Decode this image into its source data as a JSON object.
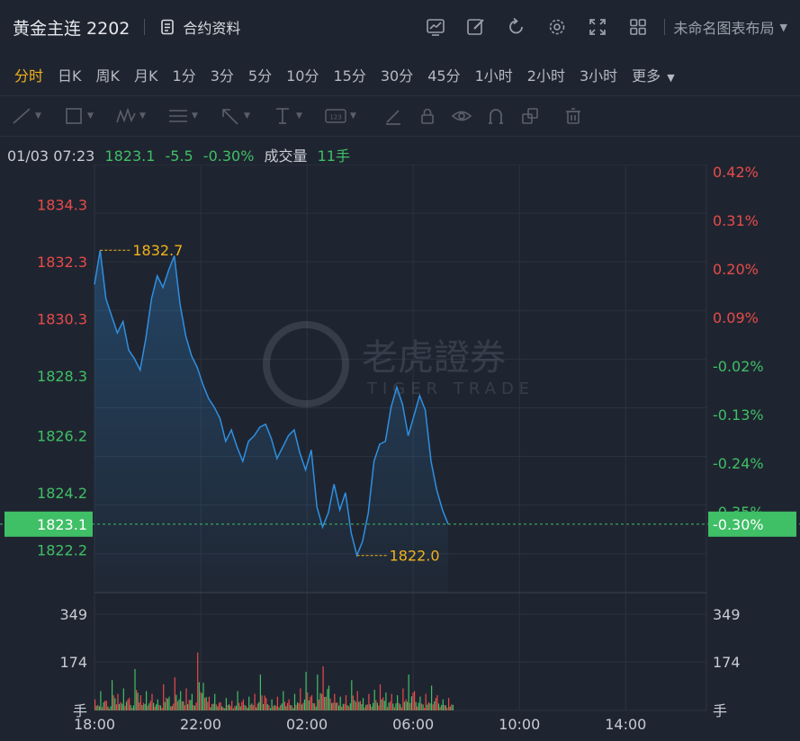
{
  "header": {
    "title": "黄金主连 2202",
    "contract_info_label": "合约资料",
    "layout_label": "未命名图表布局",
    "tool_icons": [
      "indicator-chart-icon",
      "draw-pen-icon",
      "refresh-icon",
      "settings-gear-icon",
      "fullscreen-icon",
      "grid-layout-icon"
    ]
  },
  "periods": {
    "items": [
      "分时",
      "日K",
      "周K",
      "月K",
      "1分",
      "3分",
      "5分",
      "10分",
      "15分",
      "30分",
      "45分",
      "1小时",
      "2小时",
      "3小时",
      "更多"
    ],
    "active": "分时"
  },
  "drawing_tools": [
    "line-tool-icon",
    "rectangle-tool-icon",
    "wave-pattern-icon",
    "fibonacci-icon",
    "arrow-tool-icon",
    "vertical-line-icon",
    "label-tool-icon",
    "pen-icon",
    "lock-icon",
    "eye-icon",
    "magnet-icon",
    "layers-icon",
    "trash-icon"
  ],
  "info": {
    "datetime": "01/03 07:23",
    "price": "1823.1",
    "change": "-5.5",
    "change_pct": "-0.30%",
    "volume_label": "成交量",
    "volume_value": "11手"
  },
  "watermark": {
    "cn": "老虎證券",
    "en": "TIGER TRADE"
  },
  "colors": {
    "up": "#e84a4a",
    "down": "#3fbf66",
    "line": "#2f8fe0",
    "accent": "#f2b21b",
    "grid": "#2b3340",
    "bg": "#1f2530"
  },
  "chart_data": {
    "type": "line",
    "price_ticks_left": [
      "1834.3",
      "1832.3",
      "1830.3",
      "1828.3",
      "1826.2",
      "1824.2",
      "1822.2"
    ],
    "price_ticks_left_values": [
      1834.3,
      1832.3,
      1830.3,
      1828.3,
      1826.2,
      1824.2,
      1822.2
    ],
    "pct_ticks_right": [
      "0.42%",
      "0.31%",
      "0.20%",
      "0.09%",
      "-0.02%",
      "-0.13%",
      "-0.24%",
      "-0.35%"
    ],
    "current_price": "1823.1",
    "current_pct": "-0.30%",
    "high_label": "1832.7",
    "low_label": "1822.0",
    "x_ticks": [
      "18:00",
      "22:00",
      "02:00",
      "06:00",
      "10:00",
      "14:00"
    ],
    "ylim": [
      1820.7,
      1835.7
    ],
    "series": [
      {
        "values": [
          1831.5,
          1832.7,
          1831.0,
          1830.4,
          1829.8,
          1830.2,
          1829.2,
          1828.9,
          1828.5,
          1829.6,
          1831.0,
          1831.8,
          1831.4,
          1832.0,
          1832.5,
          1830.8,
          1829.7,
          1829.0,
          1828.6,
          1828.0,
          1827.5,
          1827.2,
          1826.8,
          1826.0,
          1826.4,
          1825.8,
          1825.3,
          1826.0,
          1826.2,
          1826.5,
          1826.6,
          1826.1,
          1825.4,
          1825.8,
          1826.2,
          1826.4,
          1825.6,
          1825.0,
          1825.7,
          1823.7,
          1823.0,
          1823.5,
          1824.5,
          1823.6,
          1824.2,
          1822.8,
          1822.0,
          1822.5,
          1823.5,
          1825.3,
          1825.9,
          1826.0,
          1827.2,
          1827.9,
          1827.3,
          1826.2,
          1826.9,
          1827.6,
          1827.1,
          1825.3,
          1824.3,
          1823.6,
          1823.1
        ],
        "volume": [
          40,
          70,
          35,
          110,
          60,
          80,
          45,
          150,
          55,
          70,
          60,
          40,
          95,
          50,
          120,
          70,
          80,
          60,
          210,
          100,
          50,
          60,
          30,
          45,
          35,
          70,
          40,
          50,
          60,
          130,
          45,
          40,
          50,
          70,
          40,
          60,
          80,
          140,
          55,
          130,
          160,
          90,
          60,
          50,
          55,
          110,
          70,
          45,
          60,
          75,
          95,
          65,
          60,
          55,
          80,
          130,
          70,
          50,
          60,
          90,
          55,
          40,
          45
        ]
      }
    ],
    "volume_ticks": [
      "349",
      "174",
      "手"
    ],
    "volume_tick_values": [
      349,
      174
    ]
  }
}
